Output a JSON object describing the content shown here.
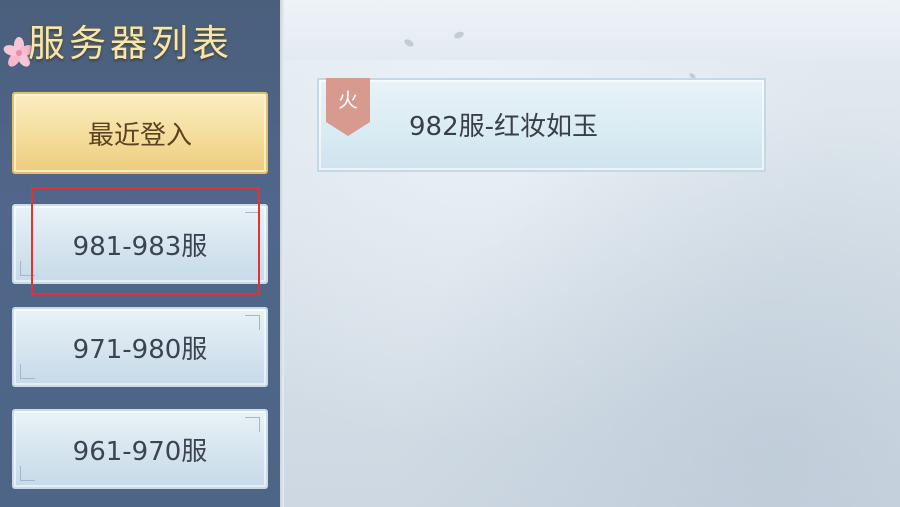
{
  "sidebar": {
    "title": "服务器列表",
    "buttons": [
      {
        "label": "最近登入",
        "style": "recent"
      },
      {
        "label": "981-983服",
        "style": "range",
        "highlighted": true
      },
      {
        "label": "971-980服",
        "style": "range"
      },
      {
        "label": "961-970服",
        "style": "range"
      }
    ]
  },
  "main": {
    "servers": [
      {
        "tag": "火",
        "name": "982服-红妆如玉"
      }
    ]
  },
  "colors": {
    "sidebar_bg": "#4d6586",
    "title_gold": "#f6e7b0",
    "recent_gold": "#f4dc9a",
    "range_blue": "#d3e3ee",
    "highlight_red": "#e23232",
    "hot_tag": "#d79a8f"
  },
  "icons": [
    "cherry-blossom-icon",
    "hot-tag-icon"
  ]
}
